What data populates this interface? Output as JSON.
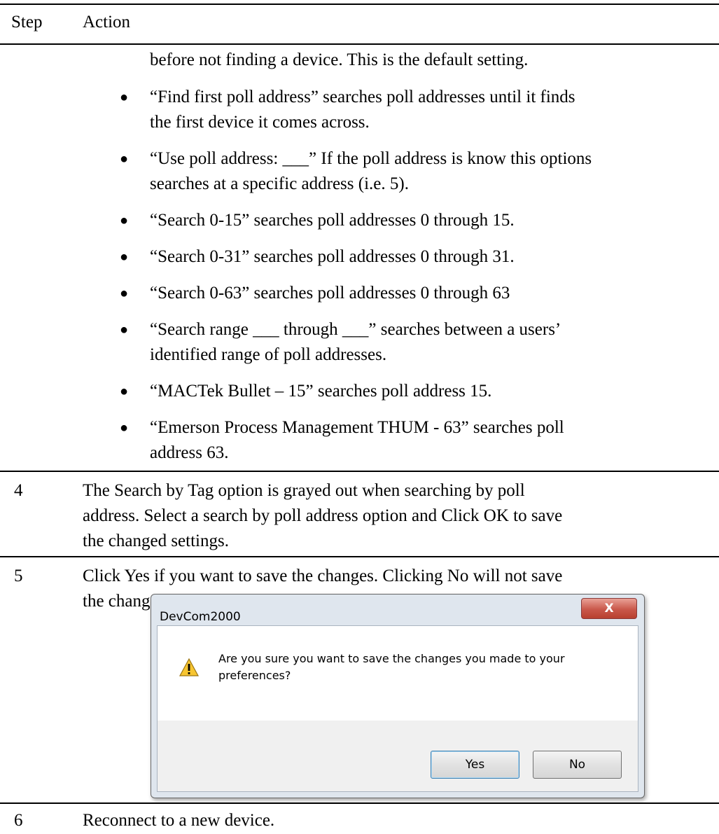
{
  "header": {
    "step": "Step",
    "action": "Action"
  },
  "continued": {
    "first_line": "before not finding a device.  This is the default setting.",
    "bullets": [
      {
        "lines": [
          "“Find first poll address” searches poll addresses until it finds",
          "the first device it comes across."
        ]
      },
      {
        "lines": [
          "“Use poll address: ___” If the poll address is know this options",
          "searches at a specific address (i.e. 5)."
        ]
      },
      {
        "lines": [
          "“Search 0-15” searches poll addresses 0 through 15."
        ]
      },
      {
        "lines": [
          "“Search 0-31” searches poll addresses 0 through 31."
        ]
      },
      {
        "lines": [
          "“Search 0-63” searches poll addresses 0 through 63"
        ]
      },
      {
        "lines": [
          "“Search range ___ through ___” searches between a users’",
          "identified range of poll addresses."
        ]
      },
      {
        "lines": [
          "“MACTek Bullet – 15” searches poll address 15."
        ]
      },
      {
        "lines": [
          "“Emerson Process Management THUM - 63” searches poll",
          "address 63."
        ]
      }
    ]
  },
  "steps": [
    {
      "num": "4",
      "lines": [
        "The Search by Tag option is grayed out when searching by poll",
        "address.  Select a search by poll address option and Click OK to save",
        "the changed settings."
      ]
    },
    {
      "num": "5",
      "lines": [
        "Click Yes if you want to save the changes. Clicking No will not save",
        "the changes."
      ]
    },
    {
      "num": "6",
      "lines": [
        "Reconnect to a new device."
      ]
    }
  ],
  "dialog": {
    "title": "DevCom2000",
    "close_glyph": "X",
    "icon": "warning-icon",
    "message": "Are you sure you want to save the changes you made to your preferences?",
    "yes_label": "Yes",
    "no_label": "No"
  }
}
